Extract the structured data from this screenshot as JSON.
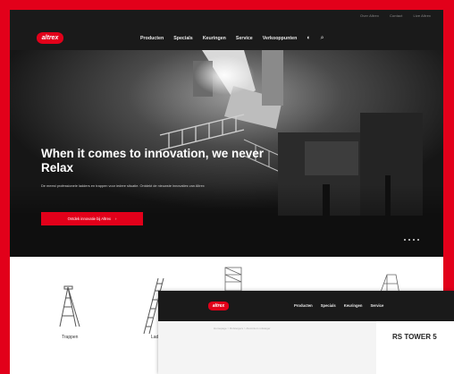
{
  "site": {
    "logo_text": "altrex",
    "topbar_links": [
      "Over Altrex",
      "Contact",
      "Live Altrex"
    ],
    "nav": [
      "Producten",
      "Specials",
      "Keuringen",
      "Service",
      "Verkooppunten"
    ],
    "icons": [
      "globe-icon",
      "search-icon"
    ]
  },
  "hero": {
    "title": "When it comes to innovation, we never Relax",
    "subtitle": "De meest professionele ladders en trappen voor iedere situatie. Ontdekt de nieuwste innovaties van Altrex",
    "cta": "Ontdek innovatie bij Altrex",
    "cta_arrow": "›",
    "slide_count": 4
  },
  "products": [
    {
      "label": "Trappen"
    },
    {
      "label": "Ladders"
    }
  ],
  "second_window": {
    "logo_text": "altrex",
    "nav": [
      "Producten",
      "Specials",
      "Keuringen",
      "Service"
    ],
    "breadcrumb": "Homepage > Rolsteigers > Aluminium rolsteiger",
    "title": "RS TOWER 5"
  },
  "colors": {
    "brand_red": "#e2001a",
    "header_dark": "#1a1a1a"
  }
}
